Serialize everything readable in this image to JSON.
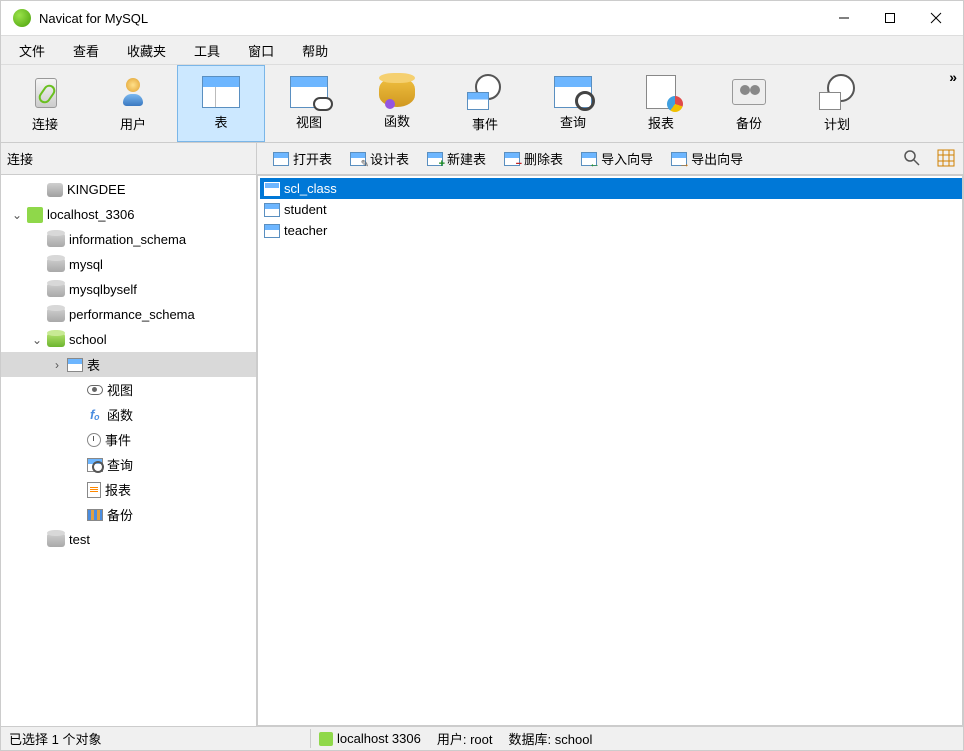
{
  "window": {
    "title": "Navicat for MySQL"
  },
  "menu": {
    "items": [
      "文件",
      "查看",
      "收藏夹",
      "工具",
      "窗口",
      "帮助"
    ]
  },
  "toolbar": {
    "items": [
      {
        "label": "连接",
        "icon": "connect"
      },
      {
        "label": "用户",
        "icon": "user"
      },
      {
        "label": "表",
        "icon": "table",
        "selected": true
      },
      {
        "label": "视图",
        "icon": "view"
      },
      {
        "label": "函数",
        "icon": "func"
      },
      {
        "label": "事件",
        "icon": "event"
      },
      {
        "label": "查询",
        "icon": "query"
      },
      {
        "label": "报表",
        "icon": "report"
      },
      {
        "label": "备份",
        "icon": "backup"
      },
      {
        "label": "计划",
        "icon": "plan"
      }
    ],
    "overflow": "»"
  },
  "panel_header": {
    "label": "连接"
  },
  "subtoolbar": {
    "items": [
      {
        "label": "打开表",
        "icon": "open"
      },
      {
        "label": "设计表",
        "icon": "edit"
      },
      {
        "label": "新建表",
        "icon": "plus"
      },
      {
        "label": "删除表",
        "icon": "minus"
      },
      {
        "label": "导入向导",
        "icon": "wiz_in"
      },
      {
        "label": "导出向导",
        "icon": "wiz_out"
      }
    ]
  },
  "tree": {
    "items": [
      {
        "label": "KINGDEE",
        "depth": 1,
        "icon": "folder-grey"
      },
      {
        "label": "localhost_3306",
        "depth": 0,
        "icon": "plug",
        "expander": "v"
      },
      {
        "label": "information_schema",
        "depth": 1,
        "icon": "db"
      },
      {
        "label": "mysql",
        "depth": 1,
        "icon": "db"
      },
      {
        "label": "mysqlbyself",
        "depth": 1,
        "icon": "db"
      },
      {
        "label": "performance_schema",
        "depth": 1,
        "icon": "db"
      },
      {
        "label": "school",
        "depth": 1,
        "icon": "db-active",
        "expander": "v"
      },
      {
        "label": "表",
        "depth": 2,
        "icon": "table",
        "expander": ">",
        "selected": true
      },
      {
        "label": "视图",
        "depth": 3,
        "icon": "view"
      },
      {
        "label": "函数",
        "depth": 3,
        "icon": "fx"
      },
      {
        "label": "事件",
        "depth": 3,
        "icon": "clock"
      },
      {
        "label": "查询",
        "depth": 3,
        "icon": "query"
      },
      {
        "label": "报表",
        "depth": 3,
        "icon": "report"
      },
      {
        "label": "备份",
        "depth": 3,
        "icon": "backup"
      },
      {
        "label": "test",
        "depth": 1,
        "icon": "db"
      }
    ]
  },
  "content": {
    "items": [
      {
        "label": "scl_class",
        "selected": true
      },
      {
        "label": "student",
        "selected": false
      },
      {
        "label": "teacher",
        "selected": false
      }
    ]
  },
  "status": {
    "selection": "已选择 1 个对象",
    "connection": "localhost 3306",
    "user_label": "用户:",
    "user_value": "root",
    "db_label": "数据库:",
    "db_value": "school"
  }
}
